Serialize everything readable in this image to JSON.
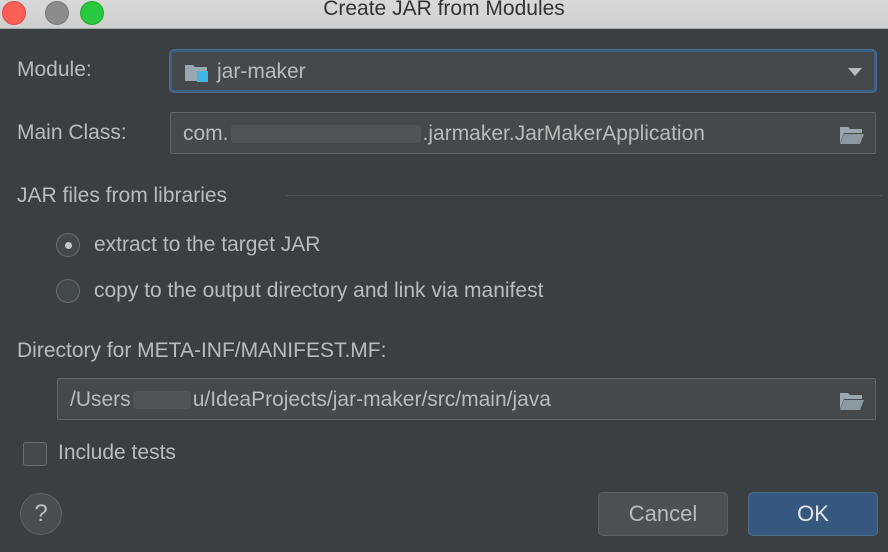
{
  "window": {
    "title": "Create JAR from Modules"
  },
  "module": {
    "label": "Module:",
    "value": "jar-maker"
  },
  "main_class": {
    "label": "Main Class:",
    "value_prefix": "com.",
    "value_suffix": ".jarmaker.JarMakerApplication"
  },
  "libraries": {
    "section_label": "JAR files from libraries",
    "options": [
      {
        "label": "extract to the target JAR",
        "selected": true
      },
      {
        "label": "copy to the output directory and link via manifest",
        "selected": false
      }
    ]
  },
  "manifest_dir": {
    "label": "Directory for META-INF/MANIFEST.MF:",
    "value_prefix": "/Users",
    "value_suffix": "u/IdeaProjects/jar-maker/src/main/java"
  },
  "include_tests": {
    "label": "Include tests",
    "checked": false
  },
  "buttons": {
    "help": "?",
    "cancel": "Cancel",
    "ok": "OK"
  },
  "colors": {
    "background": "#3c3f41",
    "primary_button": "#365880",
    "focus_border": "#3d6185"
  }
}
